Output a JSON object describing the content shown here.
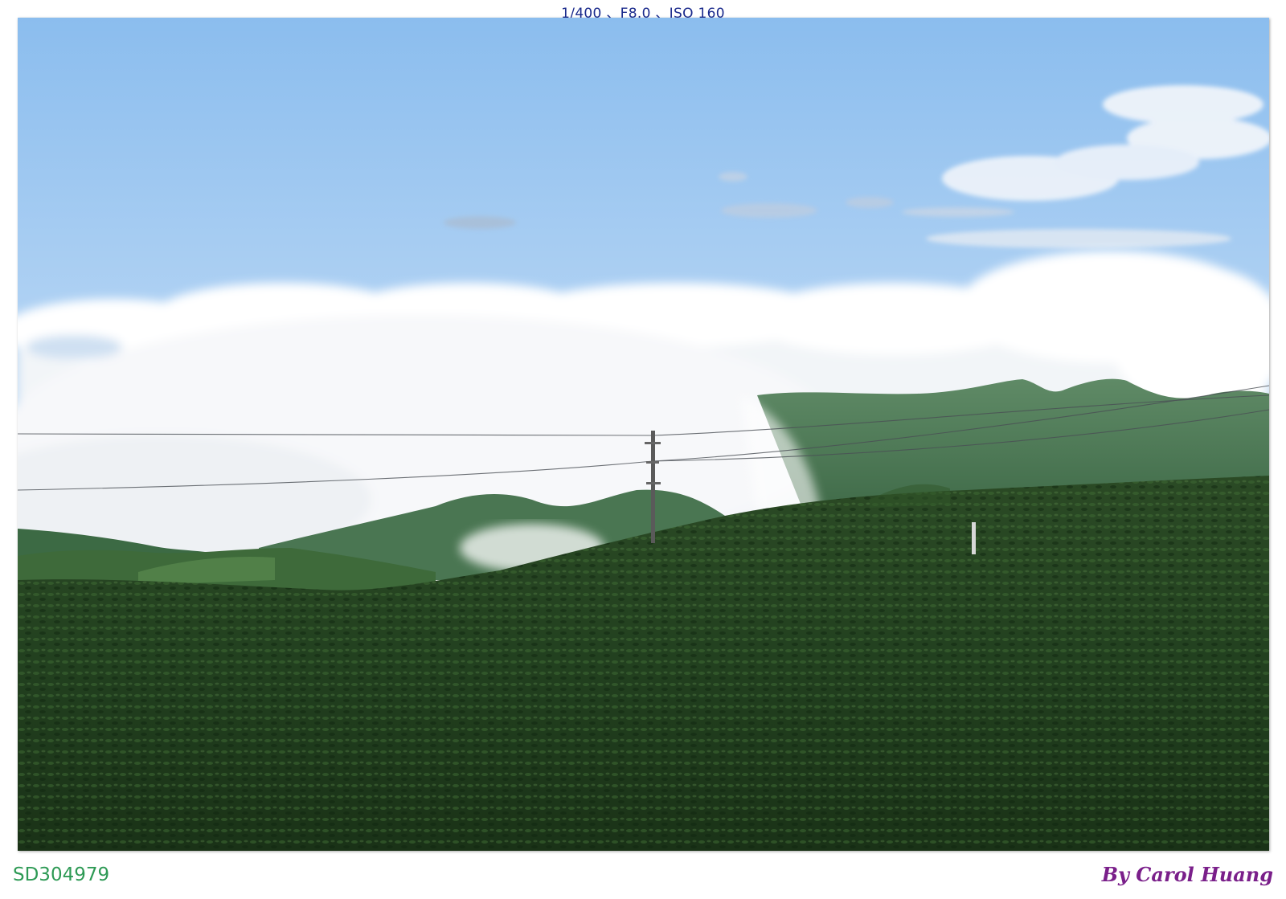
{
  "exif_caption": "1/400 、F8.0 、ISO 160",
  "photo_id": "SD304979",
  "credit": "By Carol Huang",
  "colors": {
    "sky_top": "#8fc0ee",
    "sky_bottom": "#cfe4f7",
    "cloud": "#f7f9fb",
    "mountain": "#4f7b5a",
    "tea_field": "#1f3a1c",
    "exif_text": "#1a2a8c",
    "id_text": "#2e9a55",
    "credit_text": "#7a1f8a"
  },
  "scene": {
    "subject": "tea-plantation",
    "icons": [
      "utility-pole-icon",
      "power-line-icon",
      "marker-post-icon"
    ]
  }
}
